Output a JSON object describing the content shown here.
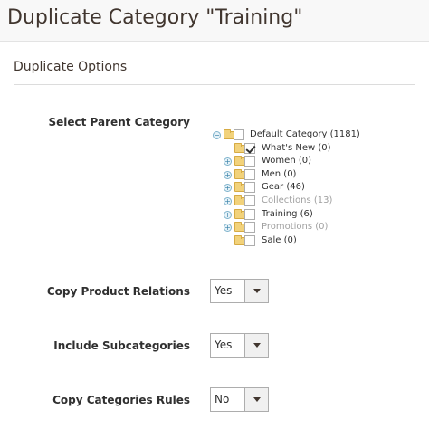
{
  "page": {
    "title": "Duplicate Category \"Training\""
  },
  "section": {
    "title": "Duplicate Options"
  },
  "fields": {
    "parent_category": {
      "label": "Select Parent Category"
    },
    "copy_product_relations": {
      "label": "Copy Product Relations",
      "value": "Yes"
    },
    "include_subcategories": {
      "label": "Include Subcategories",
      "value": "Yes"
    },
    "copy_categories_rules": {
      "label": "Copy Categories Rules",
      "value": "No"
    }
  },
  "tree": {
    "root": {
      "label": "Default Category (1181)",
      "toggle": "collapse",
      "checked": false
    },
    "nodes": [
      {
        "label": "What's New (0)",
        "toggle": "none",
        "checked": true,
        "disabled": false
      },
      {
        "label": "Women (0)",
        "toggle": "expand",
        "checked": false,
        "disabled": false
      },
      {
        "label": "Men (0)",
        "toggle": "expand",
        "checked": false,
        "disabled": false
      },
      {
        "label": "Gear (46)",
        "toggle": "expand",
        "checked": false,
        "disabled": false
      },
      {
        "label": "Collections (13)",
        "toggle": "expand",
        "checked": false,
        "disabled": true
      },
      {
        "label": "Training (6)",
        "toggle": "expand",
        "checked": false,
        "disabled": false
      },
      {
        "label": "Promotions (0)",
        "toggle": "expand",
        "checked": false,
        "disabled": true
      },
      {
        "label": "Sale (0)",
        "toggle": "none",
        "checked": false,
        "disabled": false
      }
    ]
  },
  "icons": {
    "collapse": "minus-circle-icon",
    "expand": "plus-circle-icon",
    "folder": "folder-icon",
    "dropdown": "caret-down-icon"
  }
}
